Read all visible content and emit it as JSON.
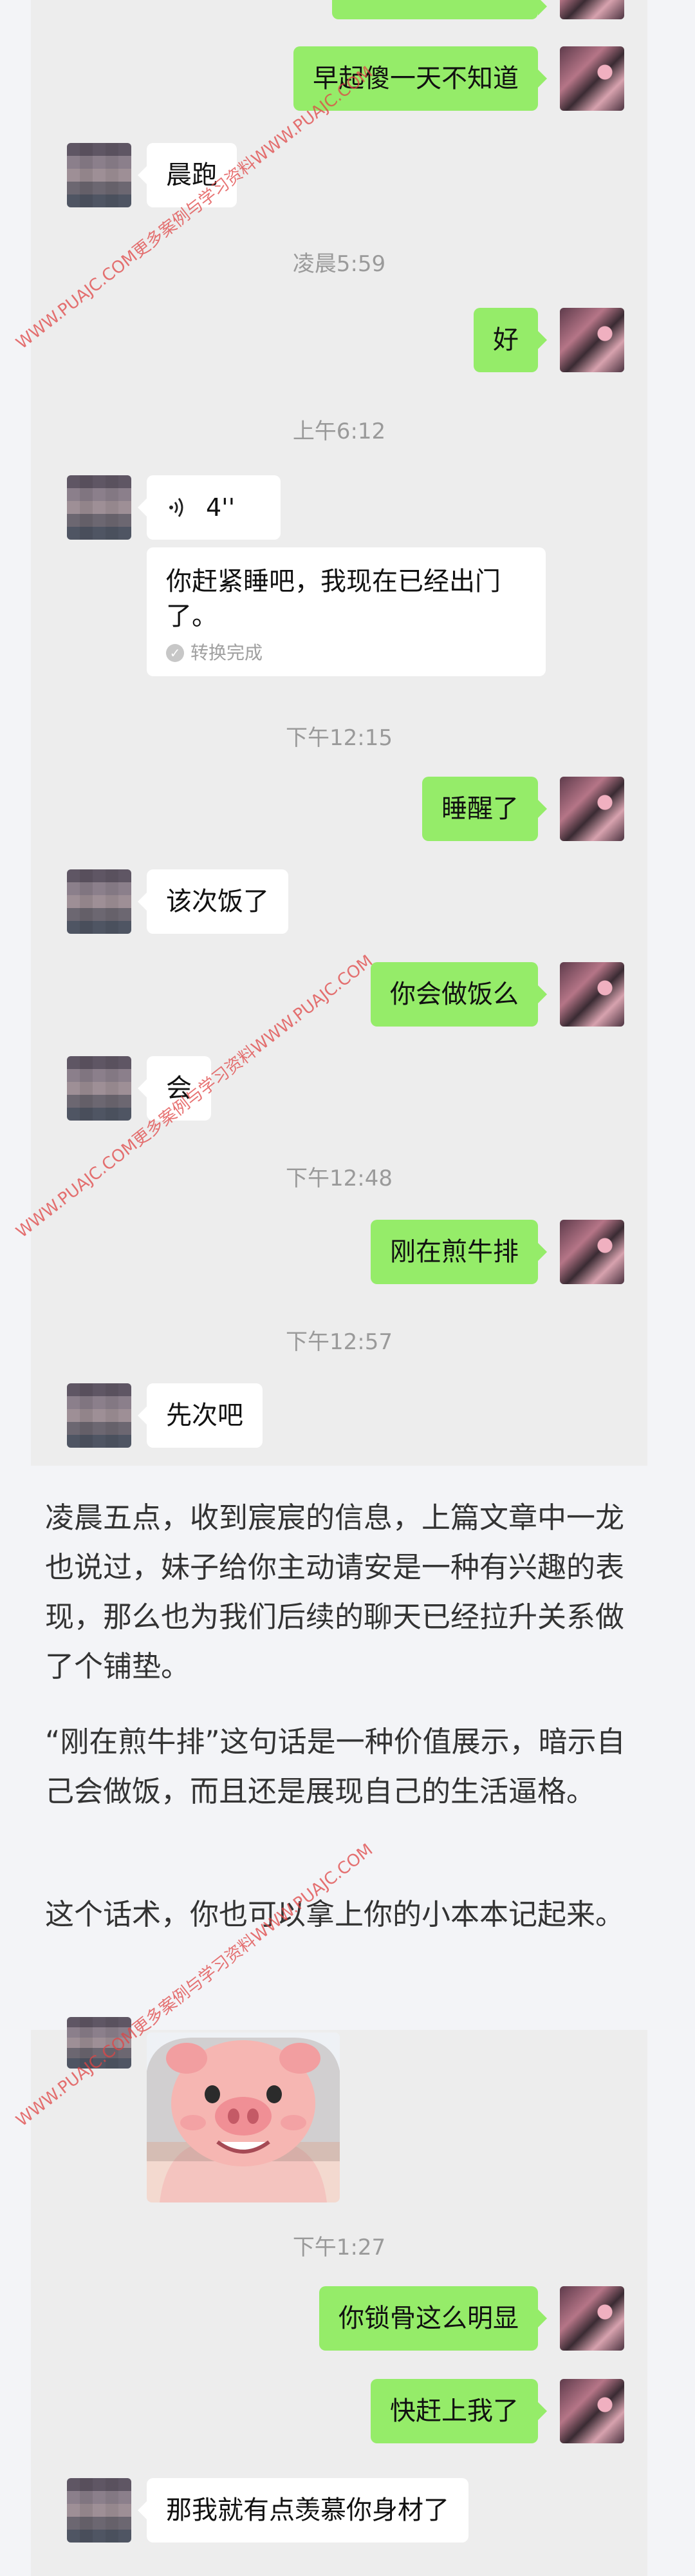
{
  "chat_top": {
    "messages": [
      {
        "side": "out",
        "text": "早起傻一天不知道"
      },
      {
        "side": "in",
        "text": "晨跑"
      },
      {
        "type": "time",
        "text": "凌晨5:59"
      },
      {
        "side": "out",
        "text": "好"
      },
      {
        "type": "time",
        "text": "上午6:12"
      },
      {
        "side": "in",
        "type": "voice",
        "duration": "4''",
        "transcript": "你赶紧睡吧，我现在已经出门了。",
        "transcript_status": "转换完成"
      },
      {
        "type": "time",
        "text": "下午12:15"
      },
      {
        "side": "out",
        "text": "睡醒了"
      },
      {
        "side": "in",
        "text": "该次饭了"
      },
      {
        "side": "out",
        "text": "你会做饭么"
      },
      {
        "side": "in",
        "text": "会"
      },
      {
        "type": "time",
        "text": "下午12:48"
      },
      {
        "side": "out",
        "text": "刚在煎牛排"
      },
      {
        "type": "time",
        "text": "下午12:57"
      },
      {
        "side": "in",
        "text": "先次吧"
      }
    ]
  },
  "article": {
    "paragraphs": [
      "凌晨五点，收到宸宸的信息，上篇文章中一龙也说过，妹子给你主动请安是一种有兴趣的表现，那么也为我们后续的聊天已经拉升关系做了个铺垫。",
      "“刚在煎牛排”这句话是一种价值展示，暗示自己会做饭，而且还是展现自己的生活逼格。",
      "这个话术，你也可以拿上你的小本本记起来。"
    ]
  },
  "chat_bottom": {
    "messages": [
      {
        "side": "in",
        "type": "sticker",
        "sticker_name": "pig-face-sticker"
      },
      {
        "type": "time",
        "text": "下午1:27"
      },
      {
        "side": "out",
        "text": "你锁骨这么明显"
      },
      {
        "side": "out",
        "text": "快赶上我了"
      },
      {
        "side": "in",
        "text": "那我就有点羡慕你身材了"
      }
    ]
  },
  "watermark": {
    "text": "WWW.PUAJC.COM更多案例与学习资料WWW.PUAJC.COM",
    "color": "#e04545"
  },
  "colors": {
    "incoming_bubble": "#ffffff",
    "outgoing_bubble": "#95ec69",
    "chat_background": "#ededed",
    "page_background": "#f3f4f7"
  }
}
